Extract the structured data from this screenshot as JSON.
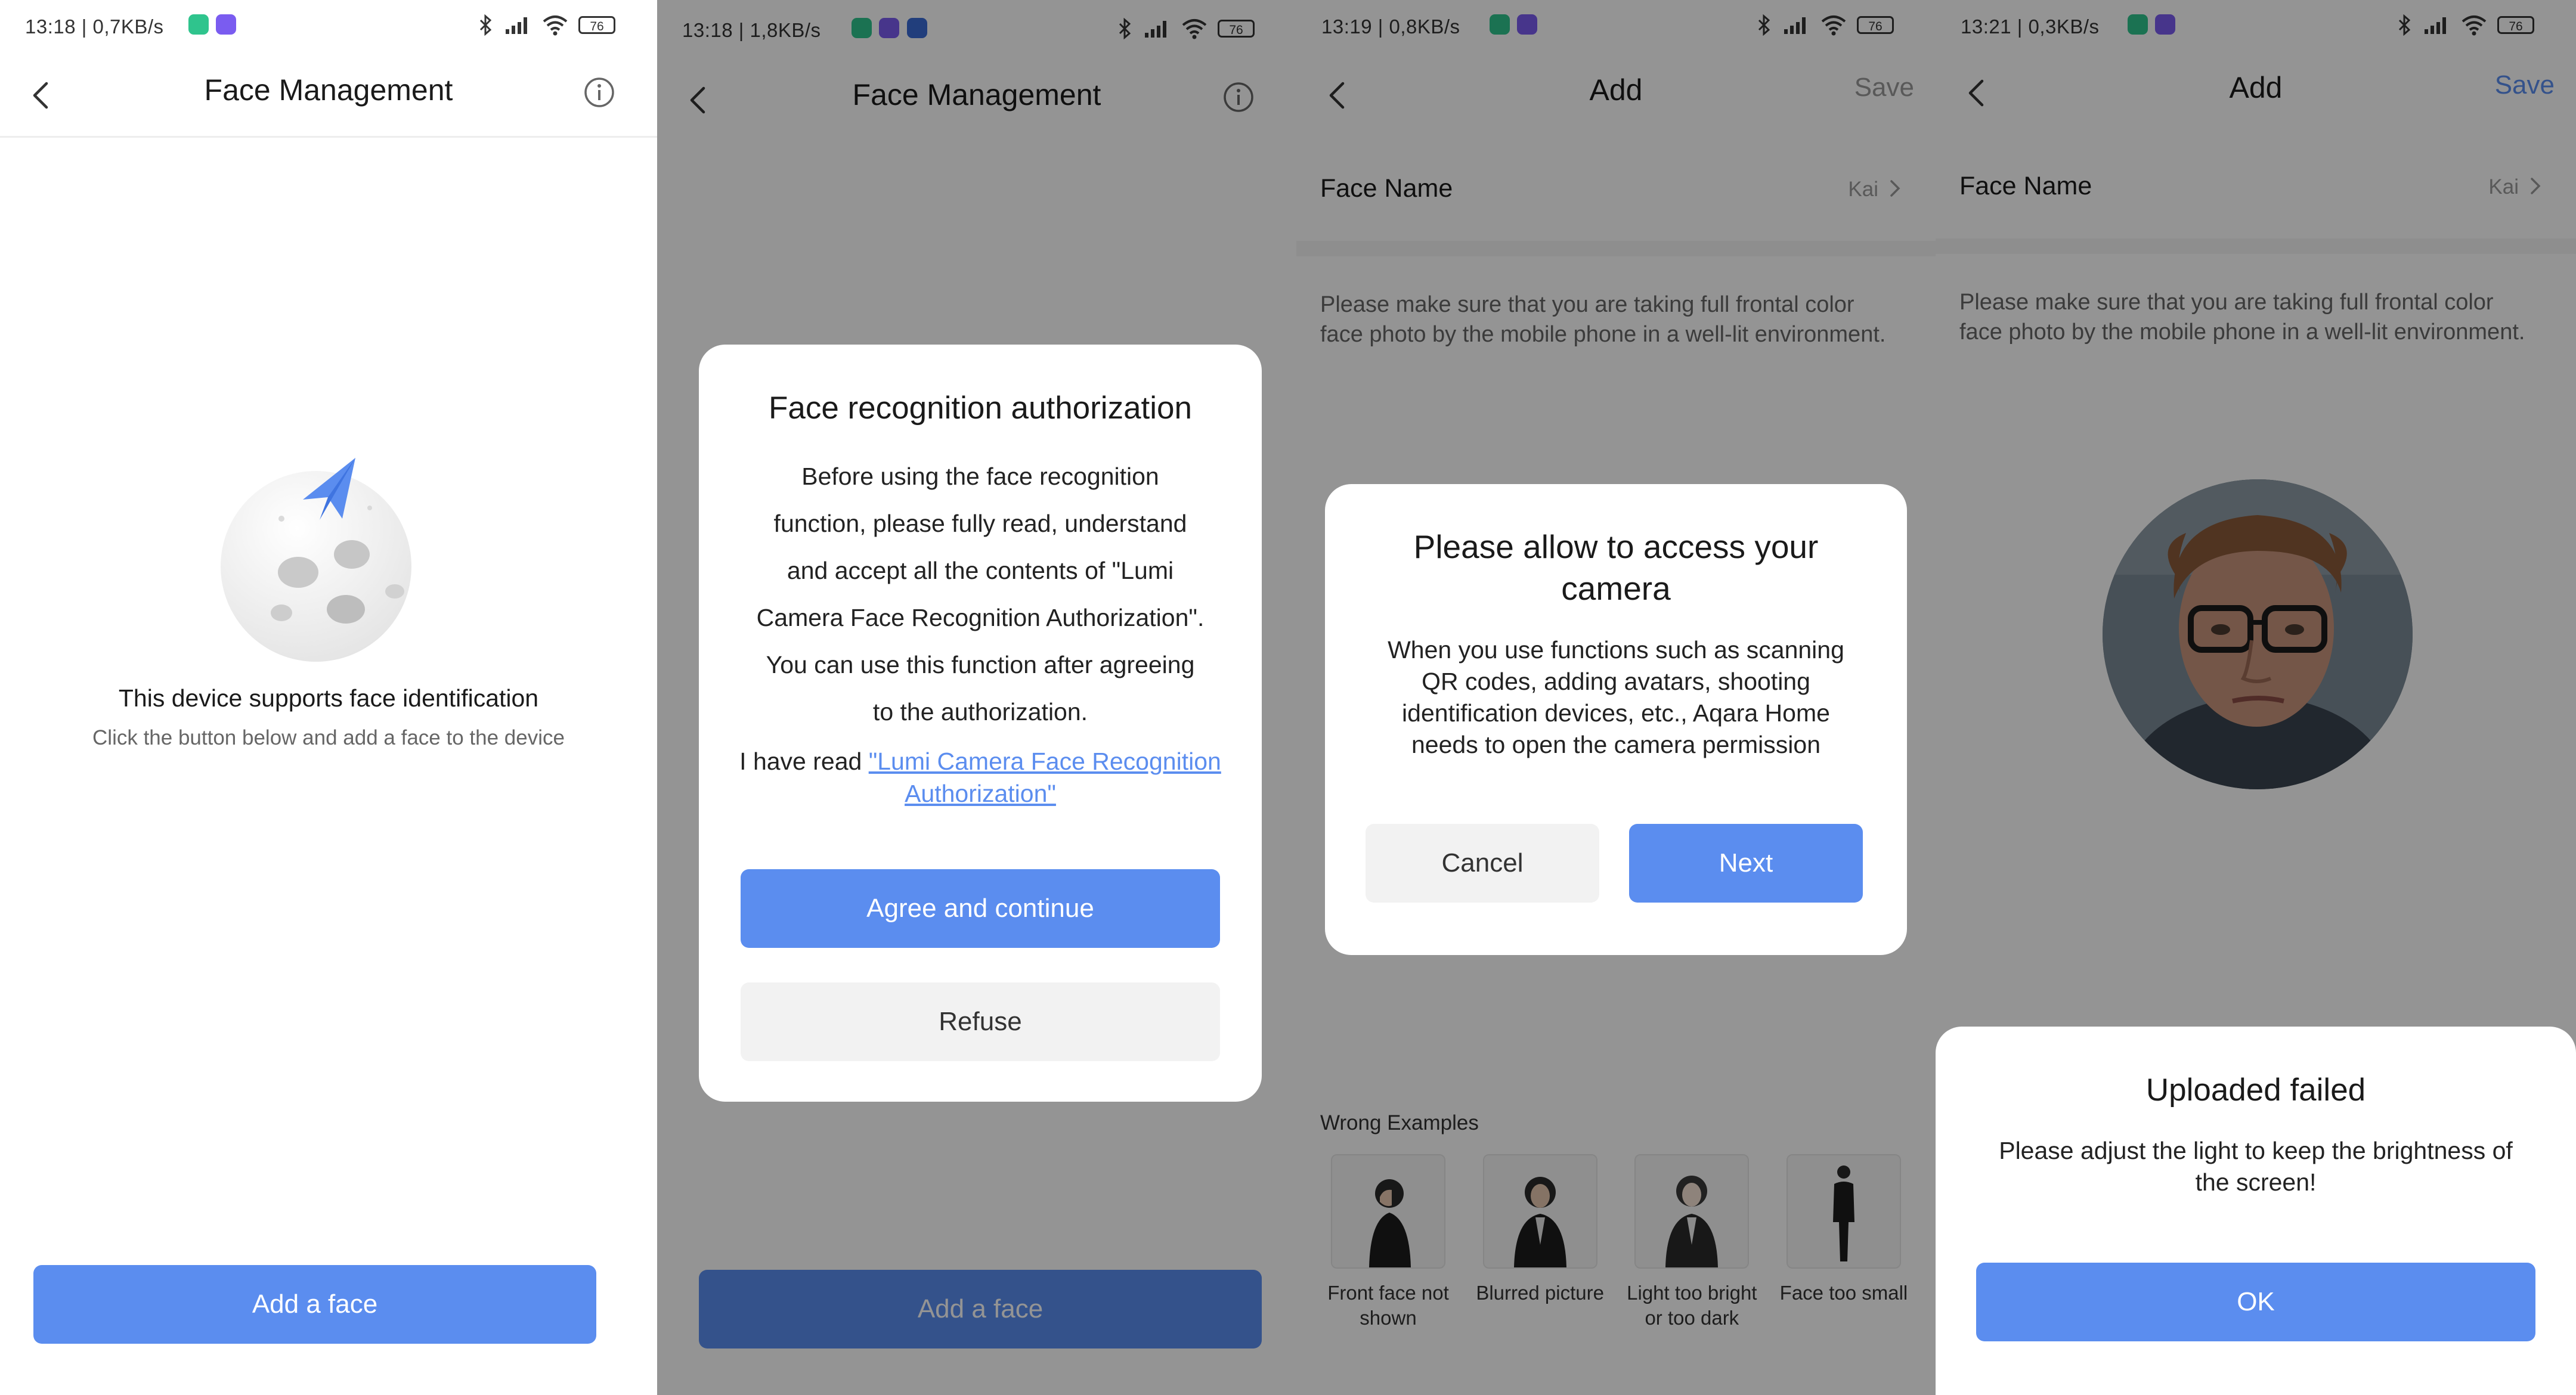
{
  "screen1": {
    "status": "13:18 | 0,7KB/s",
    "battery": "76",
    "title": "Face Management",
    "empty_title": "This device supports face identification",
    "empty_sub": "Click the button below and add a face to the device",
    "add_button": "Add a face"
  },
  "screen2": {
    "status": "13:18 | 1,8KB/s",
    "battery": "76",
    "title": "Face Management",
    "add_button": "Add a face",
    "dialog": {
      "title": "Face recognition authorization",
      "body_lines": [
        "Before using the face recognition",
        "function, please fully read, understand",
        "and accept all the contents of \"Lumi",
        "Camera Face Recognition Authorization\".",
        "You can use this function after agreeing",
        "to the authorization."
      ],
      "read_prefix": "I have read ",
      "read_link_line1": "\"Lumi Camera Face Recognition",
      "read_link_line2": "Authorization\"",
      "agree_button": "Agree and continue",
      "refuse_button": "Refuse"
    }
  },
  "screen3": {
    "status": "13:19 | 0,8KB/s",
    "battery": "76",
    "title": "Add",
    "save": "Save",
    "face_name_label": "Face Name",
    "face_name_value": "Kai",
    "hint": "Please make sure that you are taking full frontal color face photo by the mobile phone in a well-lit environment.",
    "dialog": {
      "title_line1": "Please allow to access your",
      "title_line2": "camera",
      "body_lines": [
        "When you use functions such as scanning",
        "QR codes, adding avatars, shooting",
        "identification devices, etc., Aqara Home",
        "needs to open the camera permission"
      ],
      "cancel_button": "Cancel",
      "next_button": "Next"
    },
    "wrong_title": "Wrong Examples",
    "wrong_examples": [
      {
        "caption_line1": "Front face not",
        "caption_line2": "shown"
      },
      {
        "caption_line1": "Blurred picture",
        "caption_line2": ""
      },
      {
        "caption_line1": "Light too bright",
        "caption_line2": "or too dark"
      },
      {
        "caption_line1": "Face too small",
        "caption_line2": ""
      }
    ]
  },
  "screen4": {
    "status": "13:21 | 0,3KB/s",
    "battery": "76",
    "title": "Add",
    "save": "Save",
    "face_name_label": "Face Name",
    "face_name_value": "Kai",
    "hint": "Please make sure that you are taking full frontal color face photo by the mobile phone in a well-lit environment.",
    "sheet": {
      "title": "Uploaded failed",
      "body_line1": "Please adjust the light to keep the brightness of",
      "body_line2": "the screen!",
      "ok_button": "OK"
    }
  },
  "colors": {
    "accent": "#5b8def",
    "overlay": "rgba(0,0,0,0.42)",
    "text_primary": "#1a1a1a",
    "text_secondary": "#666666"
  }
}
